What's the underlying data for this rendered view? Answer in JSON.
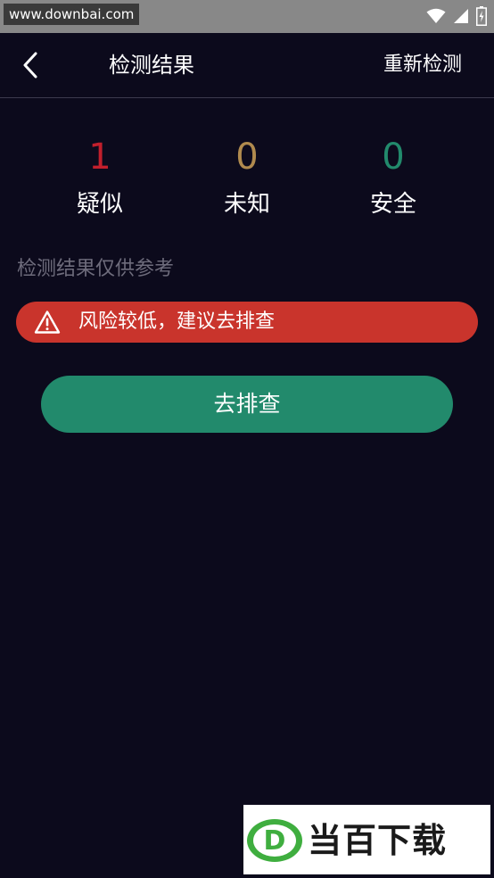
{
  "status_bar": {
    "watermark_url": "www.downbai.com"
  },
  "header": {
    "title": "检测结果",
    "recheck_label": "重新检测"
  },
  "stats": [
    {
      "value": "1",
      "label": "疑似",
      "color": "#c21f2c"
    },
    {
      "value": "0",
      "label": "未知",
      "color": "#b08a4e"
    },
    {
      "value": "0",
      "label": "安全",
      "color": "#228a6c"
    }
  ],
  "disclaimer": "检测结果仅供参考",
  "risk_banner": {
    "text": "风险较低，建议去排查",
    "color": "#c9342c",
    "icon": "warning-triangle-icon"
  },
  "action_button": {
    "label": "去排查",
    "color": "#228a6c"
  },
  "brand_watermark": {
    "logo_letter": "D",
    "text": "当百下载"
  }
}
